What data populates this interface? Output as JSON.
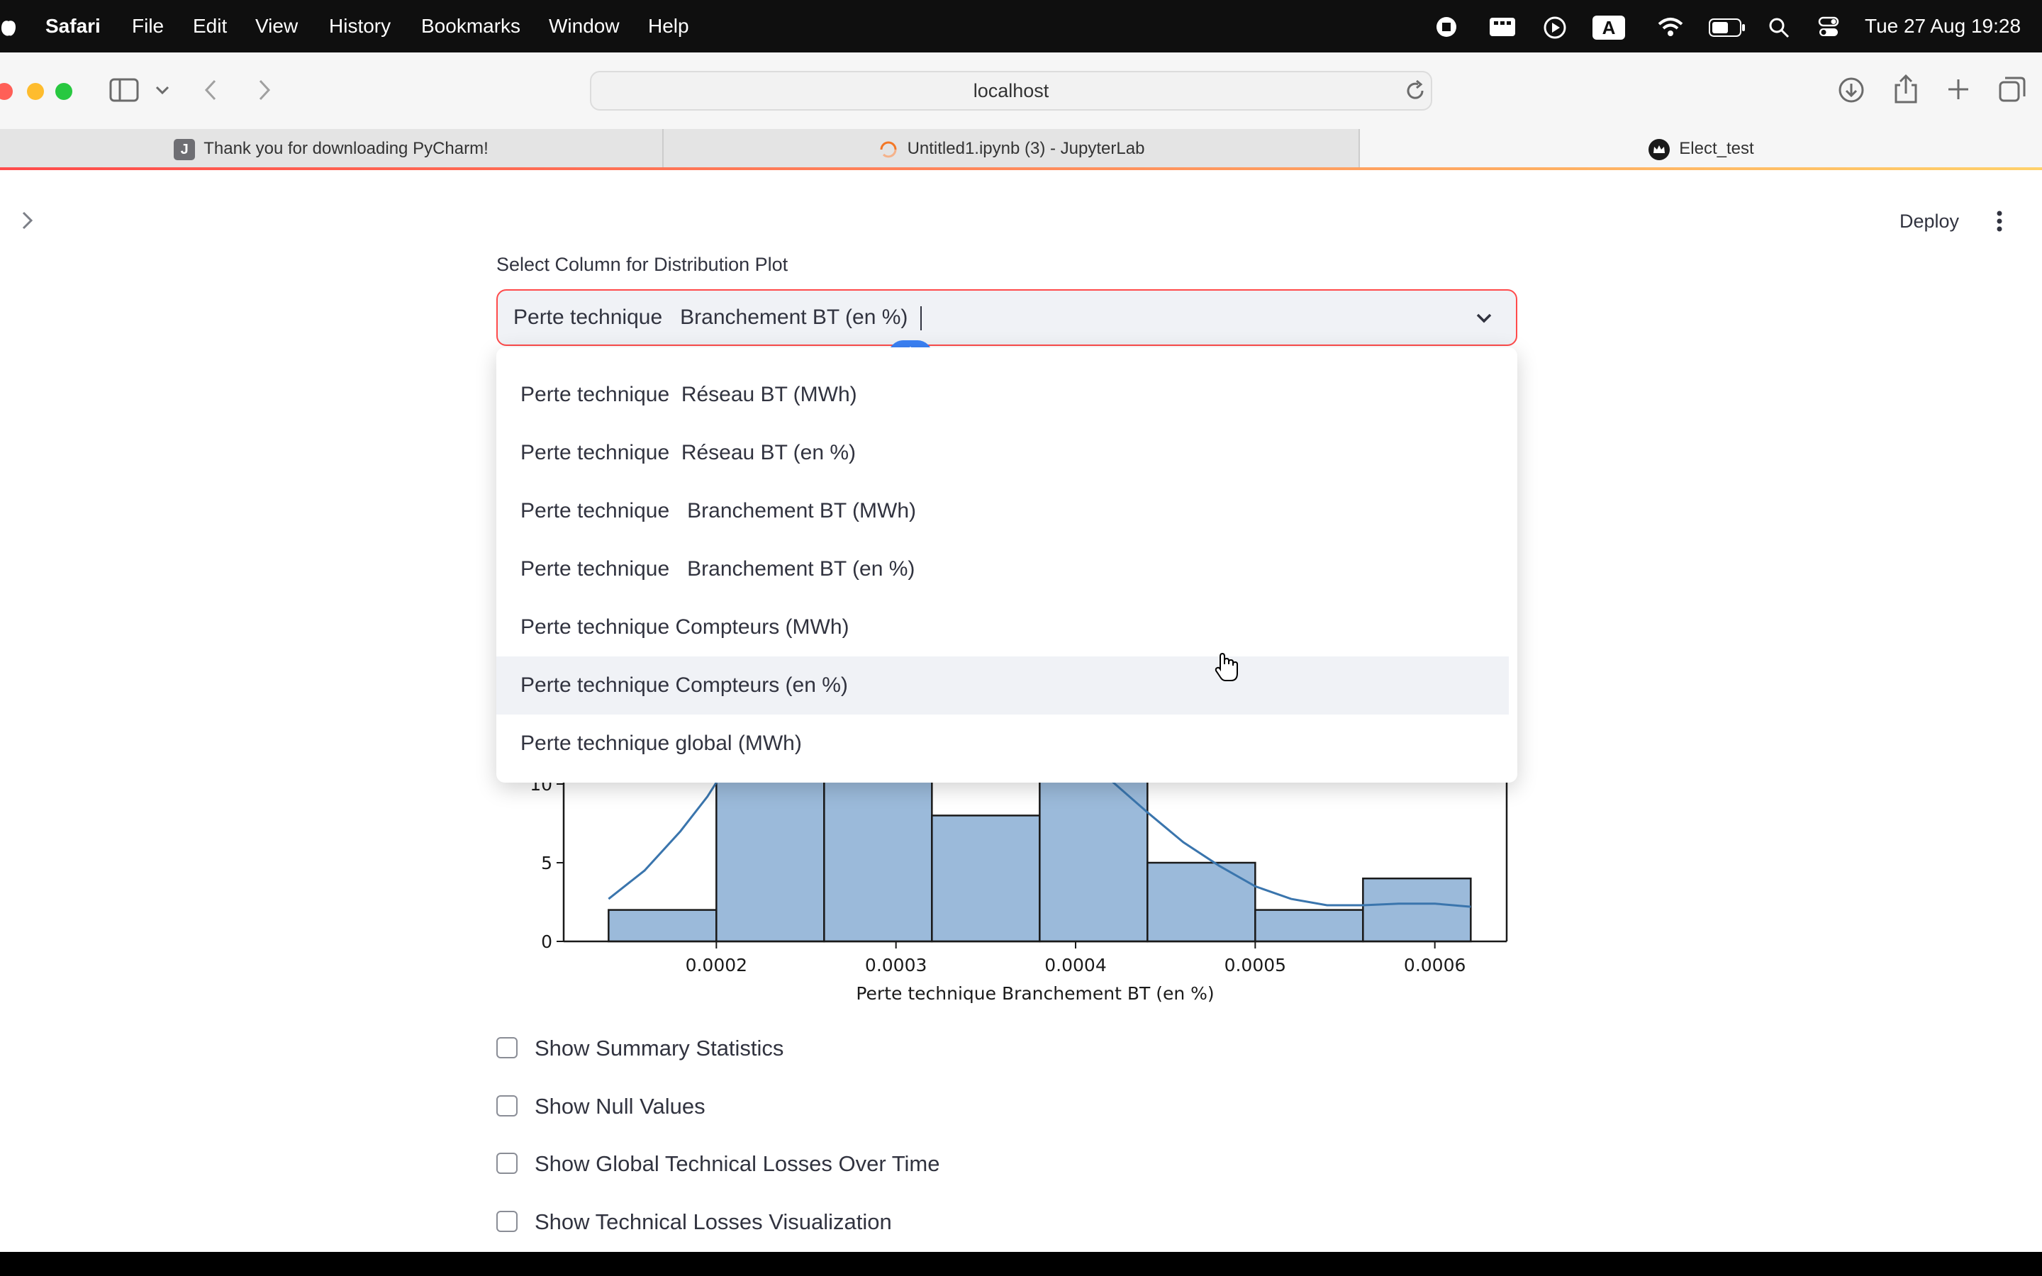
{
  "menubar": {
    "app": "Safari",
    "items": [
      "File",
      "Edit",
      "View",
      "History",
      "Bookmarks",
      "Window",
      "Help"
    ],
    "datetime": "Tue 27 Aug  19:28",
    "icons": [
      "record-icon",
      "display-icon",
      "play-icon",
      "input-source-icon",
      "wifi-icon",
      "battery-icon",
      "spotlight-icon",
      "control-center-icon"
    ],
    "input_source": "A"
  },
  "browser": {
    "url": "localhost",
    "tabs": [
      {
        "label": "Thank you for downloading PyCharm!",
        "icon": "pycharm-favicon",
        "favicon_letter": "J"
      },
      {
        "label": "Untitled1.ipynb (3) - JupyterLab",
        "icon": "loading-spinner-icon"
      },
      {
        "label": "Elect_test",
        "icon": "streamlit-crown-icon"
      }
    ]
  },
  "app": {
    "deploy_label": "Deploy",
    "select_label": "Select Column for Distribution Plot",
    "selected_value": "Perte technique   Branchement BT (en %)",
    "options": [
      "Perte technique  Réseau BT (MWh)",
      "Perte technique  Réseau BT (en %)",
      "Perte technique   Branchement BT (MWh)",
      "Perte technique   Branchement BT (en %)",
      "Perte technique Compteurs (MWh)",
      "Perte technique Compteurs (en %)",
      "Perte technique global (MWh)"
    ],
    "hovered_option_index": 5,
    "checkboxes": [
      "Show Summary Statistics",
      "Show Null Values",
      "Show Global Technical Losses Over Time",
      "Show Technical Losses Visualization"
    ]
  },
  "colors": {
    "accent": "#ff4b4b",
    "bar_fill": "#9bbada",
    "kde_line": "#3a75ad"
  },
  "chart_data": {
    "type": "bar",
    "subtype": "histogram-with-kde",
    "xlabel": "Perte technique   Branchement BT (en %)",
    "ylabel": "",
    "x_ticks": [
      "0.0002",
      "0.0003",
      "0.0004",
      "0.0005",
      "0.0006"
    ],
    "y_ticks": [
      "0",
      "5",
      "10"
    ],
    "bins": [
      {
        "x0": 0.00014,
        "x1": 0.0002,
        "count": 2
      },
      {
        "x0": 0.0002,
        "x1": 0.00026,
        "count": 13
      },
      {
        "x0": 0.00026,
        "x1": 0.00032,
        "count": 13
      },
      {
        "x0": 0.00032,
        "x1": 0.00038,
        "count": 8
      },
      {
        "x0": 0.00038,
        "x1": 0.00044,
        "count": 13
      },
      {
        "x0": 0.00044,
        "x1": 0.0005,
        "count": 5
      },
      {
        "x0": 0.0005,
        "x1": 0.00056,
        "count": 2
      },
      {
        "x0": 0.00056,
        "x1": 0.00062,
        "count": 4
      }
    ],
    "kde": [
      [
        0.00014,
        2.7
      ],
      [
        0.00016,
        4.5
      ],
      [
        0.00018,
        7.0
      ],
      [
        0.000195,
        9.2
      ],
      [
        0.000205,
        11.0
      ],
      [
        0.0004,
        11.5
      ],
      [
        0.00042,
        10.2
      ],
      [
        0.00044,
        8.2
      ],
      [
        0.00046,
        6.3
      ],
      [
        0.00048,
        4.8
      ],
      [
        0.0005,
        3.5
      ],
      [
        0.00052,
        2.7
      ],
      [
        0.00054,
        2.3
      ],
      [
        0.00056,
        2.3
      ],
      [
        0.00058,
        2.4
      ],
      [
        0.0006,
        2.4
      ],
      [
        0.00062,
        2.2
      ]
    ],
    "xlim": [
      0.000115,
      0.00064
    ],
    "ylim": [
      0,
      13
    ],
    "grid": false
  }
}
